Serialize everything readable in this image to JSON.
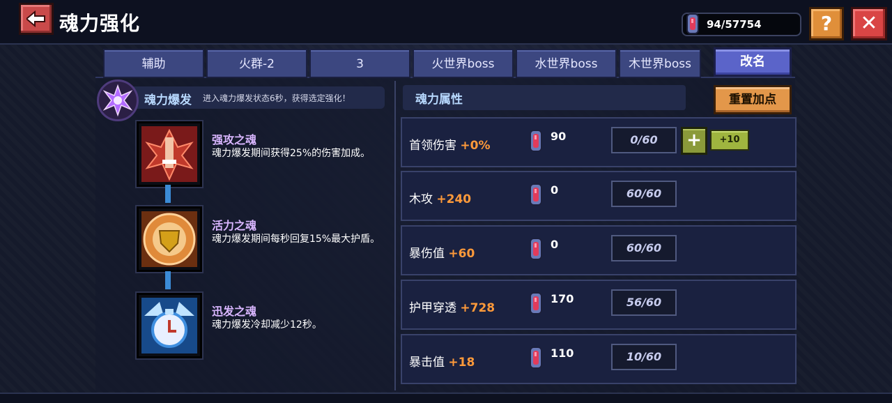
{
  "header": {
    "title": "魂力强化",
    "currency": "94/57754",
    "help_label": "?",
    "close_label": "✕"
  },
  "tabs": [
    {
      "label": "辅助"
    },
    {
      "label": "火群-2"
    },
    {
      "label": "3"
    },
    {
      "label": "火世界boss"
    },
    {
      "label": "水世界boss"
    },
    {
      "label": "木世界boss"
    }
  ],
  "rename_label": "改名",
  "burst": {
    "title": "魂力爆发",
    "description": "进入魂力爆发状态6秒，获得选定强化！"
  },
  "skills": [
    {
      "name": "强攻之魂",
      "description": "魂力爆发期间获得25%的伤害加成。",
      "icon": "attack-soul-icon",
      "color": "#c0392b"
    },
    {
      "name": "活力之魂",
      "description": "魂力爆发期间每秒回复15%最大护盾。",
      "icon": "shield-soul-icon",
      "color": "#e08a3a"
    },
    {
      "name": "迅发之魂",
      "description": "魂力爆发冷却减少12秒。",
      "icon": "clock-soul-icon",
      "color": "#3f8fe0"
    }
  ],
  "attributes": {
    "title": "魂力属性",
    "reset_label": "重置加点",
    "rows": [
      {
        "name": "首领伤害",
        "bonus": "+0%",
        "cost": "90",
        "level": "0/60",
        "plus": "+",
        "plus10": "+10"
      },
      {
        "name": "木攻",
        "bonus": "+240",
        "cost": "0",
        "level": "60/60"
      },
      {
        "name": "暴伤值",
        "bonus": "+60",
        "cost": "0",
        "level": "60/60"
      },
      {
        "name": "护甲穿透",
        "bonus": "+728",
        "cost": "170",
        "level": "56/60"
      },
      {
        "name": "暴击值",
        "bonus": "+18",
        "cost": "110",
        "level": "10/60"
      }
    ]
  },
  "colors": {
    "accent_orange": "#ff9a3a",
    "tab_blue": "#3c4780",
    "title_light_blue": "#b8d9ff"
  }
}
